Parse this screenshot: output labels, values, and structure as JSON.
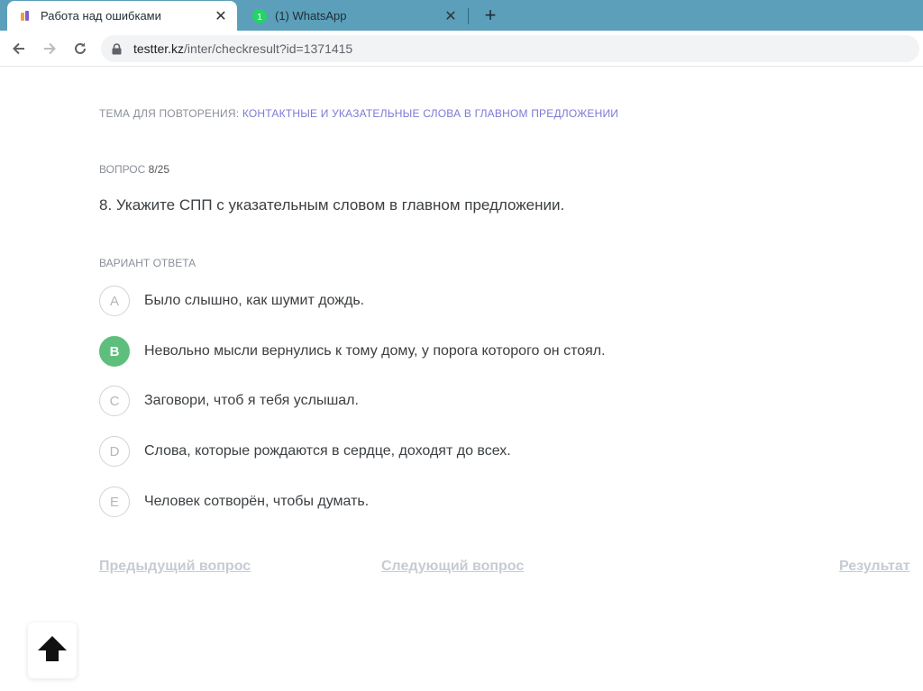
{
  "browser": {
    "tabs": [
      {
        "title": "Работа над ошибками",
        "icon": "site-favicon",
        "active": true
      },
      {
        "title": "(1) WhatsApp",
        "icon": "whatsapp-icon",
        "badge": "1",
        "active": false
      }
    ],
    "url_host": "testter.kz",
    "url_path": "/inter/checkresult?id=1371415"
  },
  "page": {
    "topic_label": "ТЕМА ДЛЯ ПОВТОРЕНИЯ:",
    "topic_value": "КОНТАКТНЫЕ И УКАЗАТЕЛЬНЫЕ СЛОВА В ГЛАВНОМ ПРЕДЛОЖЕНИИ",
    "question_label": "ВОПРОС",
    "question_counter": "8/25",
    "question_text": "8. Укажите СПП с указательным словом в главном предложении.",
    "answer_label": "ВАРИАНТ ОТВЕТА",
    "options": [
      {
        "letter": "A",
        "text": "Было слышно, как шумит дождь.",
        "correct": false
      },
      {
        "letter": "B",
        "text": "Невольно мысли вернулись к тому дому, у порога которого он стоял.",
        "correct": true
      },
      {
        "letter": "C",
        "text": "Заговори, чтоб я тебя услышал.",
        "correct": false
      },
      {
        "letter": "D",
        "text": "Слова, которые рождаются в сердце, доходят до всех.",
        "correct": false
      },
      {
        "letter": "E",
        "text": "Человек сотворён, чтобы думать.",
        "correct": false
      }
    ],
    "nav": {
      "prev": "Предыдущий вопрос",
      "next": "Следующий вопрос",
      "result": "Результат"
    }
  },
  "colors": {
    "tabstrip": "#5b9fba",
    "topic_link": "#7d7ad6",
    "correct": "#5ebf7c",
    "nav_link": "#c6ccd3"
  }
}
